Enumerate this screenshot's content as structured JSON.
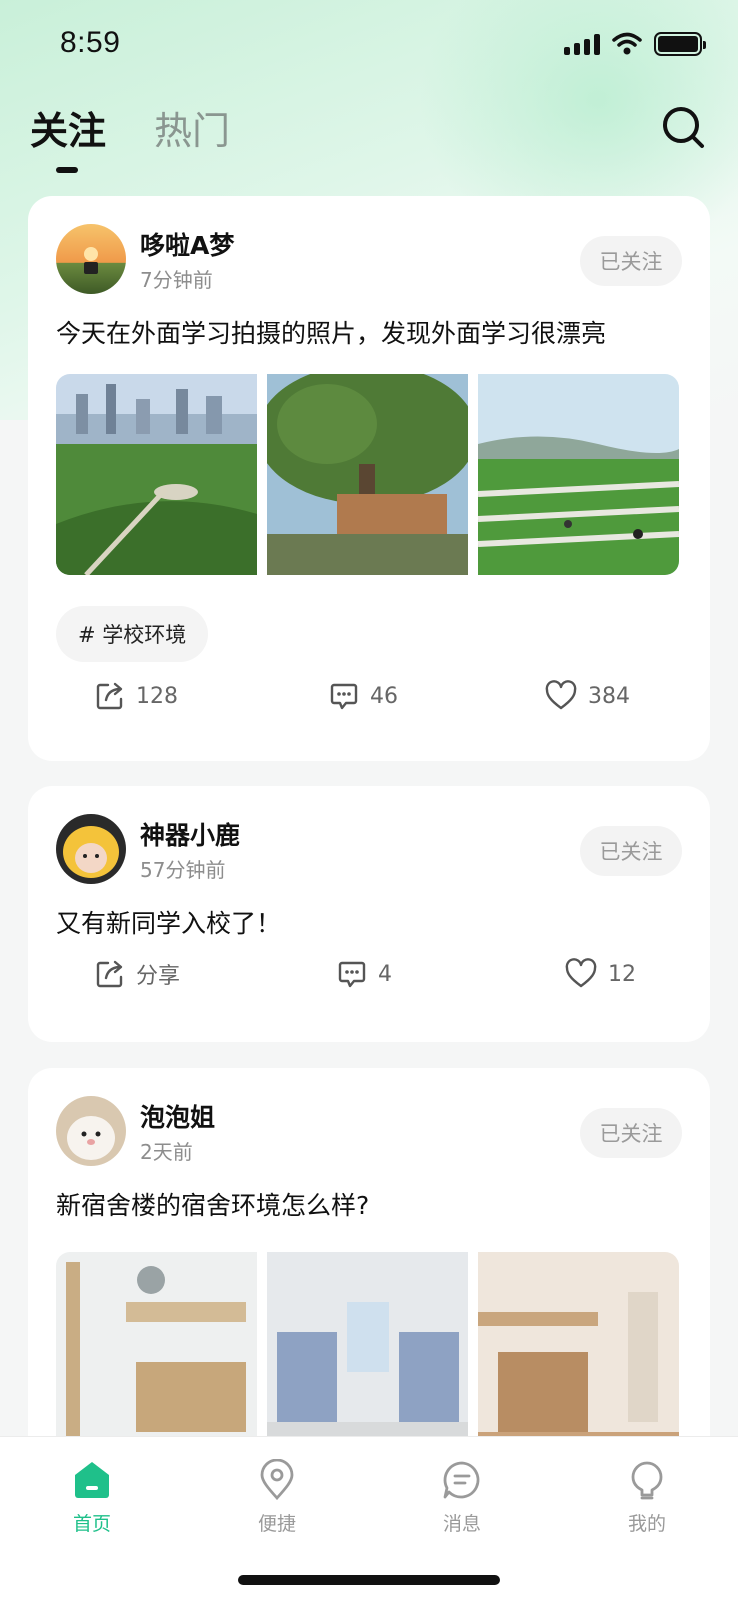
{
  "status_bar": {
    "time": "8:59"
  },
  "header": {
    "tabs": [
      {
        "label": "关注",
        "active": true
      },
      {
        "label": "热门",
        "active": false
      }
    ],
    "search_icon": "search-icon"
  },
  "posts": [
    {
      "username": "哆啦A梦",
      "time": "7分钟前",
      "follow_label": "已关注",
      "text": "今天在外面学习拍摄的照片，发现外面学习很漂亮",
      "images": [
        "campus-city-park",
        "old-tree-building",
        "terraced-garden"
      ],
      "tag": "# 学校环境",
      "share": "128",
      "comments": "46",
      "likes": "384"
    },
    {
      "username": "神器小鹿",
      "time": "57分钟前",
      "follow_label": "已关注",
      "text": "又有新同学入校了！",
      "share": "分享",
      "comments": "4",
      "likes": "12"
    },
    {
      "username": "泡泡姐",
      "time": "2天前",
      "follow_label": "已关注",
      "text": "新宿舍楼的宿舍环境怎么样?",
      "images": [
        "dorm-room-1",
        "dorm-room-2",
        "dorm-room-3"
      ]
    }
  ],
  "bottom_nav": [
    {
      "label": "首页",
      "icon": "home-icon",
      "active": true
    },
    {
      "label": "便捷",
      "icon": "location-icon",
      "active": false
    },
    {
      "label": "消息",
      "icon": "message-icon",
      "active": false
    },
    {
      "label": "我的",
      "icon": "profile-icon",
      "active": false
    }
  ],
  "colors": {
    "accent": "#1fc08a",
    "background": "#f5f6f6"
  }
}
